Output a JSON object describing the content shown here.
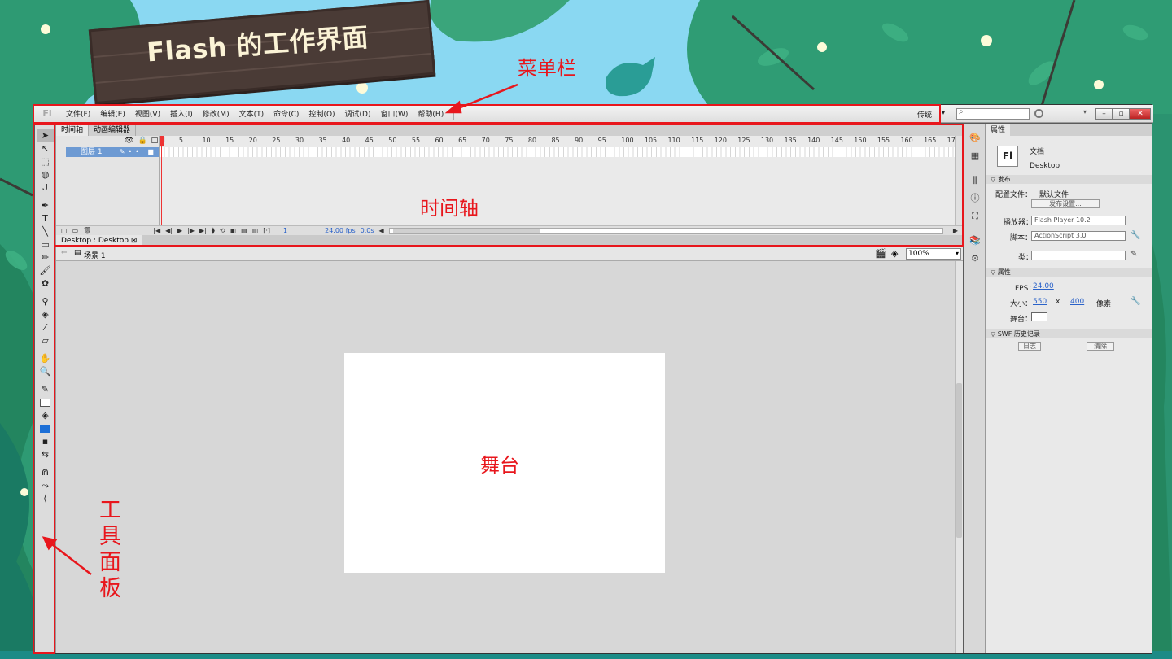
{
  "slide": {
    "title": "Flash 的工作界面",
    "annotations": {
      "menubar": "菜单栏",
      "timeline": "时间轴",
      "stage": "舞台",
      "tools": "工具面板"
    }
  },
  "app": {
    "logo": "Fl",
    "menus": [
      "文件(F)",
      "编辑(E)",
      "视图(V)",
      "插入(I)",
      "修改(M)",
      "文本(T)",
      "命令(C)",
      "控制(O)",
      "调试(D)",
      "窗口(W)",
      "帮助(H)"
    ],
    "workspace_mode": "传统",
    "search_placeholder": ""
  },
  "timeline": {
    "tabs": [
      "时间轴",
      "动画编辑器"
    ],
    "layer_name": "图层 1",
    "ruler": [
      "1",
      "5",
      "10",
      "15",
      "20",
      "25",
      "30",
      "35",
      "40",
      "45",
      "50",
      "55",
      "60",
      "65",
      "70",
      "75",
      "80",
      "85",
      "90",
      "95",
      "100",
      "105",
      "110",
      "115",
      "120",
      "125",
      "130",
      "135",
      "140",
      "145",
      "150",
      "155",
      "160",
      "165",
      "17"
    ],
    "current_frame": "1",
    "fps": "24.00",
    "fps_unit": "fps",
    "time": "0.0s"
  },
  "document": {
    "tab": "Desktop : Desktop",
    "scene": "场景 1",
    "zoom": "100%"
  },
  "properties": {
    "tab": "属性",
    "doc_type": "文档",
    "doc_name": "Desktop",
    "publish_section": "发布",
    "profile_label": "配置文件：",
    "profile_value": "默认文件",
    "publish_settings_button": "发布设置...",
    "player_label": "播放器：",
    "player_value": "Flash Player 10.2",
    "script_label": "脚本：",
    "script_value": "ActionScript 3.0",
    "class_label": "类：",
    "class_value": "",
    "props_section": "属性",
    "fps_label": "FPS：",
    "fps_value": "24.00",
    "size_label": "大小：",
    "width": "550",
    "size_x": "x",
    "height": "400",
    "size_unit": "像素",
    "stage_label": "舞台：",
    "stage_color": "#ffffff",
    "swf_section": "SWF 历史记录",
    "log_button": "日志",
    "clear_button": "清除"
  },
  "colors": {
    "annotation": "#e8161c",
    "accent_blue": "#2a62c9",
    "fill_swatch": "#1c6fd6"
  }
}
